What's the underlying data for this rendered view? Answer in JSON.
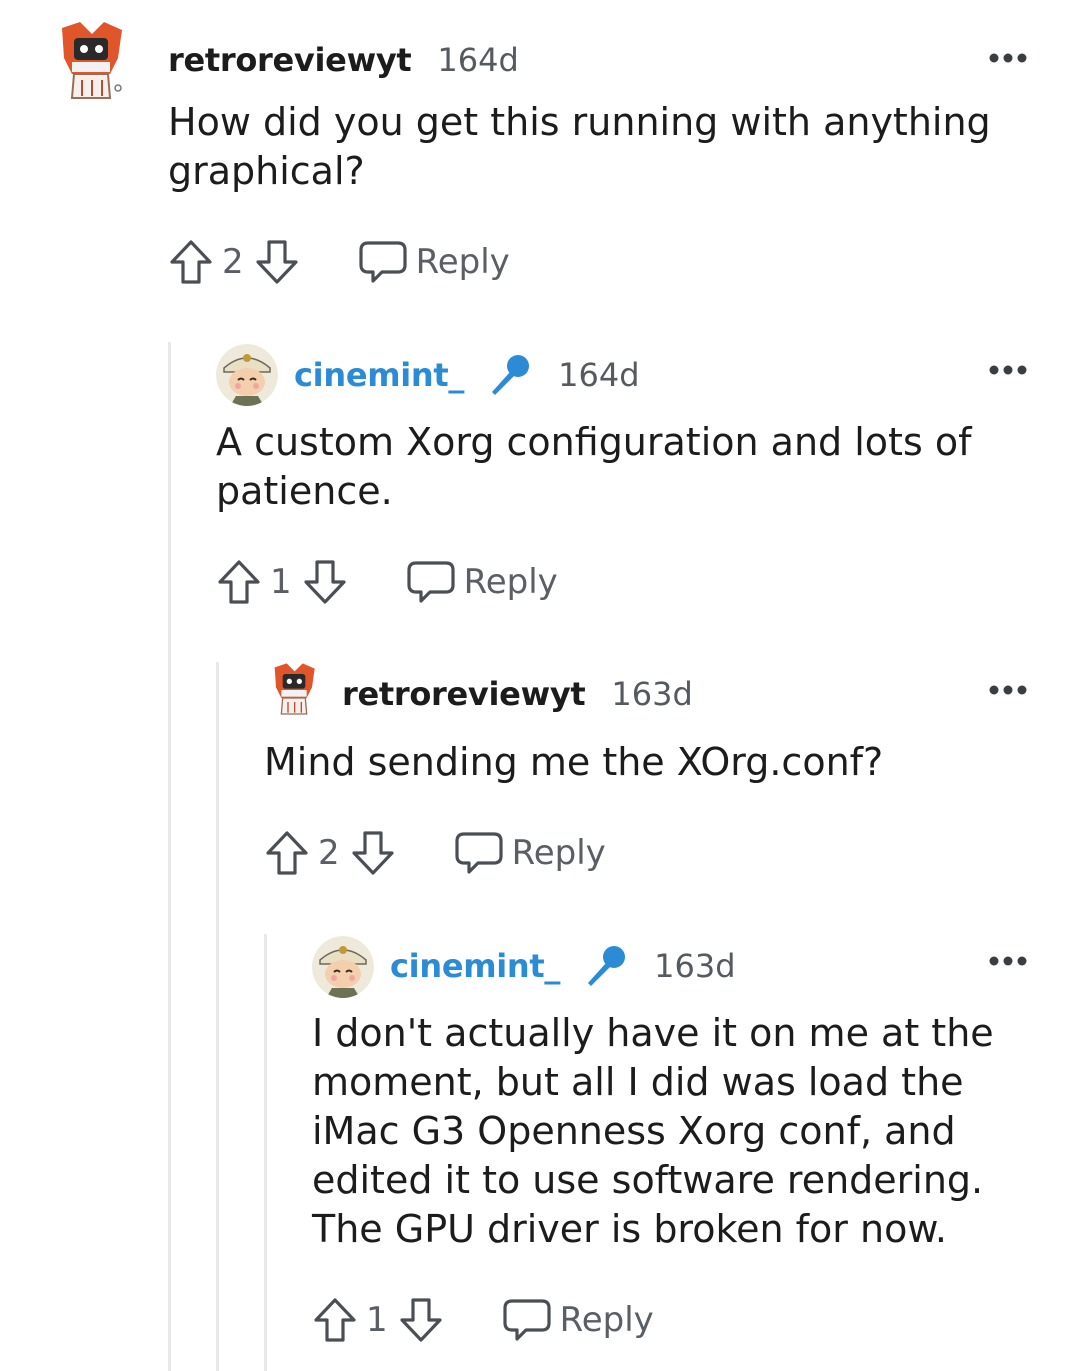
{
  "comments": [
    {
      "username": "retroreviewyt",
      "is_op": false,
      "age": "164d",
      "body": "How did you get this running with anything graphical?",
      "score": "2",
      "reply_label": "Reply",
      "avatar_icon": "robot-avatar-icon"
    },
    {
      "username": "cinemint_",
      "is_op": true,
      "age": "164d",
      "body": "A custom Xorg configuration and lots of patience.",
      "score": "1",
      "reply_label": "Reply",
      "avatar_icon": "character-avatar-icon"
    },
    {
      "username": "retroreviewyt",
      "is_op": false,
      "age": "163d",
      "body": "Mind sending me the XOrg.conf?",
      "score": "2",
      "reply_label": "Reply",
      "avatar_icon": "robot-avatar-icon"
    },
    {
      "username": "cinemint_",
      "is_op": true,
      "age": "163d",
      "body": "I don't actually have it on me at the moment, but all I did was load the iMac G3 Openness Xorg conf, and edited it to use software rendering. The GPU driver is broken for now.",
      "score": "1",
      "reply_label": "Reply",
      "avatar_icon": "character-avatar-icon"
    }
  ],
  "colors": {
    "op_username": "#2b8bd4",
    "text": "#1c1c1c",
    "muted": "#5a5f66",
    "thread_line": "#e7e8ea"
  }
}
